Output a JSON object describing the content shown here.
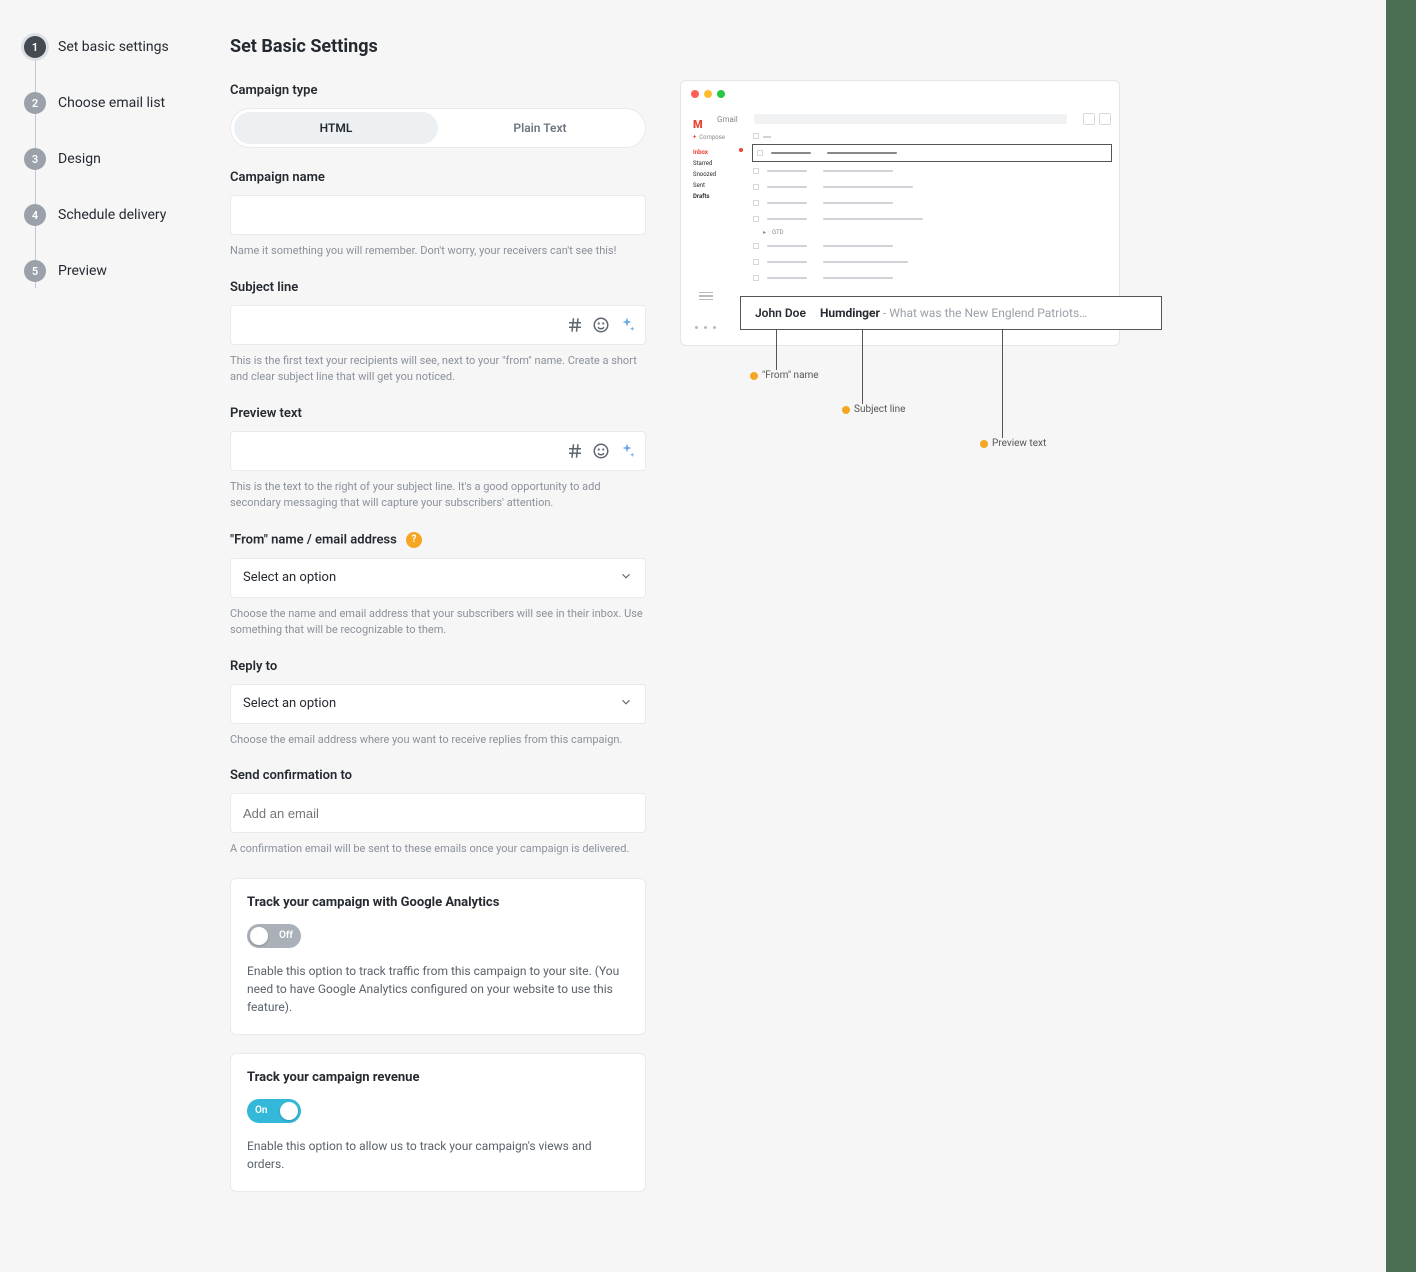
{
  "steps": [
    {
      "num": "1",
      "label": "Set basic settings"
    },
    {
      "num": "2",
      "label": "Choose email list"
    },
    {
      "num": "3",
      "label": "Design"
    },
    {
      "num": "4",
      "label": "Schedule delivery"
    },
    {
      "num": "5",
      "label": "Preview"
    }
  ],
  "page": {
    "title": "Set Basic Settings"
  },
  "campaign_type": {
    "label": "Campaign type",
    "options": {
      "html": "HTML",
      "plain": "Plain Text"
    }
  },
  "campaign_name": {
    "label": "Campaign name",
    "help": "Name it something you will remember. Don't worry, your receivers can't see this!"
  },
  "subject": {
    "label": "Subject line",
    "help": "This is the first text your recipients will see, next to your \"from\" name. Create a short and clear subject line that will get you noticed."
  },
  "preview_text": {
    "label": "Preview text",
    "help": "This is the text to the right of your subject line. It's a good opportunity to add secondary messaging that will capture your subscribers' attention."
  },
  "from": {
    "label": "\"From\" name / email address",
    "placeholder": "Select an option",
    "help": "Choose the name and email address that your subscribers will see in their inbox. Use something that will be recognizable to them."
  },
  "reply_to": {
    "label": "Reply to",
    "placeholder": "Select an option",
    "help": "Choose the email address where you want to receive replies from this campaign."
  },
  "confirm": {
    "label": "Send confirmation to",
    "placeholder": "Add an email",
    "help": "A confirmation email will be sent to these emails once your campaign is delivered."
  },
  "ga": {
    "title": "Track your campaign with Google Analytics",
    "state": "Off",
    "desc": "Enable this option to track traffic from this campaign to your site. (You need to have Google Analytics configured on your website to use this feature)."
  },
  "revenue": {
    "title": "Track your campaign revenue",
    "state": "On",
    "desc": "Enable this option to allow us to track your campaign's views and orders."
  },
  "mock": {
    "brand": "Gmail",
    "compose": "Compose",
    "sidebar": {
      "inbox": "Inbox",
      "starred": "Starred",
      "snoozed": "Snoozed",
      "sent": "Sent",
      "drafts": "Drafts",
      "cat": "GTD"
    },
    "callout": {
      "from": "John Doe",
      "subject": "Humdinger",
      "preview": "- What was the New Englend Patriots…"
    },
    "leaders": {
      "from": "\"From\" name",
      "subject": "Subject line",
      "preview": "Preview text"
    }
  },
  "help_icon": "?"
}
